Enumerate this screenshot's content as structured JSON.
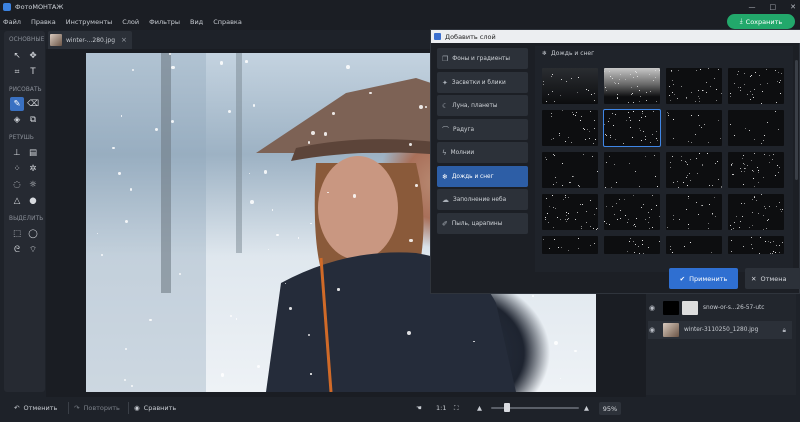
{
  "app": {
    "title": "ФотоМОНТАЖ",
    "window_controls": [
      "—",
      "□",
      "✕"
    ]
  },
  "menu": [
    "Файл",
    "Правка",
    "Инструменты",
    "Слой",
    "Фильтры",
    "Вид",
    "Справка"
  ],
  "save_button": {
    "label": "Сохранить",
    "color": "#22a86b"
  },
  "tools": {
    "sections": [
      "ОСНОВНЫЕ",
      "РИСОВАТЬ",
      "РЕТУШЬ",
      "ВЫДЕЛИТЬ"
    ]
  },
  "tab": {
    "filename": "winter-...280.jpg",
    "close": "×"
  },
  "bottom": {
    "undo": "Отменить",
    "redo": "Повторить",
    "compare": "Сравнить",
    "ratio": "1:1",
    "zoom": "95%"
  },
  "layers": [
    {
      "name": "snow-or-s...26-57-utc",
      "icon": "eye-icon"
    },
    {
      "name": "winter-3110250_1280.jpg",
      "icon": "eye-icon",
      "locked": true
    }
  ],
  "dialog": {
    "title": "Добавить слой",
    "categories": [
      {
        "label": "Фоны и градиенты",
        "icon": "layers-icon"
      },
      {
        "label": "Засветки и блики",
        "icon": "sparkle-icon"
      },
      {
        "label": "Луна, планеты",
        "icon": "moon-icon"
      },
      {
        "label": "Радуга",
        "icon": "rainbow-icon"
      },
      {
        "label": "Молнии",
        "icon": "lightning-icon"
      },
      {
        "label": "Дождь и снег",
        "icon": "snowflake-icon"
      },
      {
        "label": "Заполнение неба",
        "icon": "cloud-icon"
      },
      {
        "label": "Пыль, царапины",
        "icon": "scratch-icon"
      }
    ],
    "active_category": 5,
    "grid_title": "Дождь и снег",
    "apply": "Применить",
    "cancel": "Отмена",
    "accent": "#2f6fd1"
  }
}
